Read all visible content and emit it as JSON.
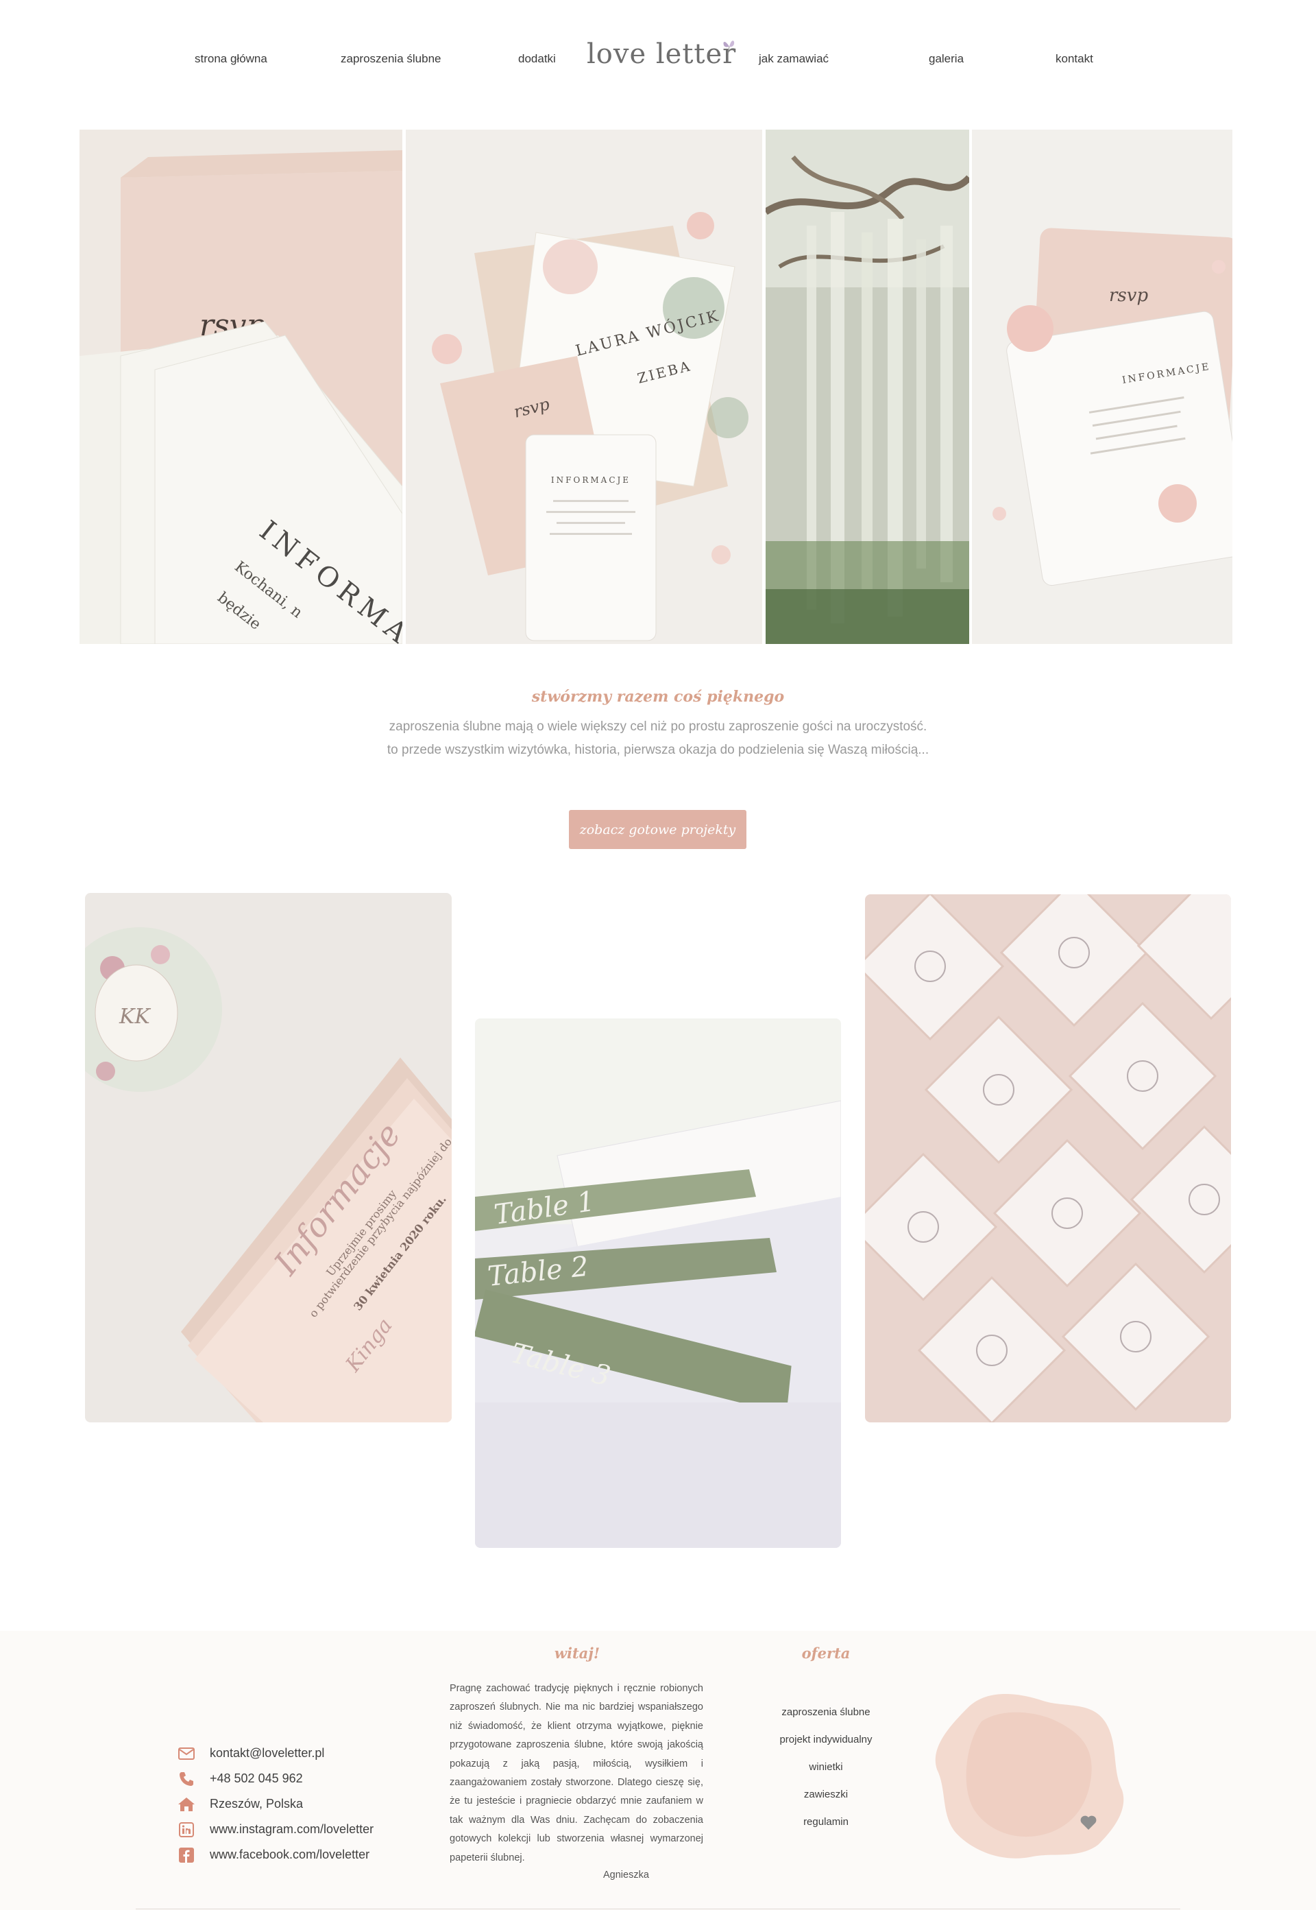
{
  "brand": {
    "logo": "love letter",
    "accent_color": "#e0b2a5",
    "heading_color": "#d8a28c"
  },
  "nav": {
    "items": [
      {
        "label": "strona główna"
      },
      {
        "label": "zaproszenia ślubne"
      },
      {
        "label": "dodatki"
      },
      {
        "label": "jak zamawiać"
      },
      {
        "label": "galeria"
      },
      {
        "label": "kontakt"
      }
    ]
  },
  "hero": {
    "images": [
      {
        "icon": "rsvp-card-photo",
        "card_script": "rsvp",
        "card_title": "INFORMA",
        "card_line1": "Kochani, n",
        "card_line2": "będzie"
      },
      {
        "icon": "invitation-set-photo",
        "card_name": "LAURA WÓJCIK",
        "card_name2": "ZIEBA",
        "card_title": "INFORMACJE",
        "card_script": "rsvp"
      },
      {
        "icon": "tree-moss-photo"
      },
      {
        "icon": "pink-card-photo",
        "card_script": "rsvp",
        "card_title": "INFORMACJE"
      }
    ]
  },
  "tagline": {
    "title": "stwórzmy razem coś pięknego",
    "line1": "zaproszenia ślubne mają o wiele większy cel niż po prostu zaproszenie gości na uroczystość.",
    "line2": "to przede wszystkim wizytówka, historia, pierwsza okazja do podzielenia się Waszą miłością..."
  },
  "cta": {
    "label": "zobacz gotowe projekty"
  },
  "gallery": [
    {
      "icon": "informacje-card-photo",
      "title": "Informacje",
      "line1": "Uprzejmie prosimy",
      "line2": "o potwierdzenie przybycia najpóźniej do",
      "line3": "30 kwietnia 2020 roku.",
      "signature": "Kinga",
      "monogram": "KK"
    },
    {
      "icon": "table-tags-photo",
      "tag1": "Table 1",
      "tag2": "Table 2",
      "tag3": "Table 3"
    },
    {
      "icon": "envelopes-photo"
    }
  ],
  "footer": {
    "contact": [
      {
        "icon": "mail-icon",
        "text": "kontakt@loveletter.pl"
      },
      {
        "icon": "phone-icon",
        "text": "+48 502 045 962"
      },
      {
        "icon": "home-icon",
        "text": "Rzeszów, Polska"
      },
      {
        "icon": "linkedin-icon",
        "text": "www.instagram.com/loveletter"
      },
      {
        "icon": "facebook-icon",
        "text": "www.facebook.com/loveletter"
      }
    ],
    "about_heading": "witaj!",
    "about_text": "Pragnę zachować tradycję pięknych i ręcznie robionych zaproszeń ślubnych. Nie ma nic bardziej wspaniałszego niż świadomość, że klient otrzyma wyjątkowe, pięknie przygotowane zaproszenia ślubne, które swoją jakością pokazują z jaką pasją, miłością, wysiłkiem i zaangażowaniem zostały stworzone. Dlatego cieszę się, że tu jesteście i pragniecie obdarzyć mnie zaufaniem w tak ważnym dla Was dniu. Zachęcam do zobaczenia gotowych kolekcji lub stworzenia własnej wymarzonej papeterii ślubnej.",
    "signature": "Agnieszka",
    "offer_heading": "oferta",
    "offer": [
      {
        "label": "zaproszenia ślubne"
      },
      {
        "label": "projekt indywidualny"
      },
      {
        "label": "winietki"
      },
      {
        "label": "zawieszki"
      },
      {
        "label": "regulamin"
      }
    ]
  }
}
